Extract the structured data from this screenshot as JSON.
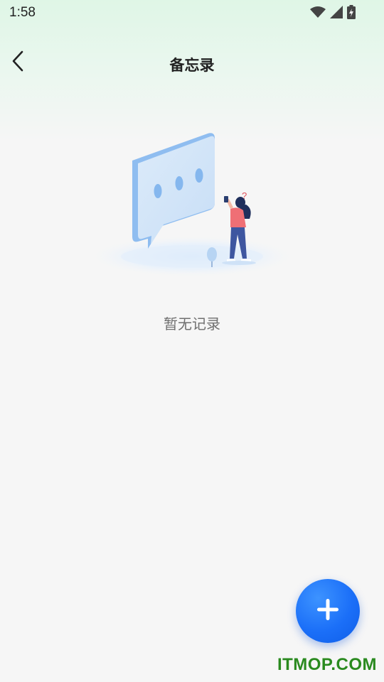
{
  "status_bar": {
    "time": "1:58",
    "icons": [
      "wifi-icon",
      "signal-icon",
      "battery-charging-icon"
    ]
  },
  "app_bar": {
    "back_icon": "chevron-left-icon",
    "title": "备忘录"
  },
  "empty_state": {
    "illustration": "chat-bubble-with-person-illustration",
    "message": "暂无记录"
  },
  "fab": {
    "icon": "plus-icon",
    "color": "#1b6ff8"
  },
  "watermark": {
    "text": "ITMOP.COM",
    "color": "#2a8a1f"
  },
  "colors": {
    "header_gradient": "#dff6e6",
    "background": "#f6f6f6"
  }
}
